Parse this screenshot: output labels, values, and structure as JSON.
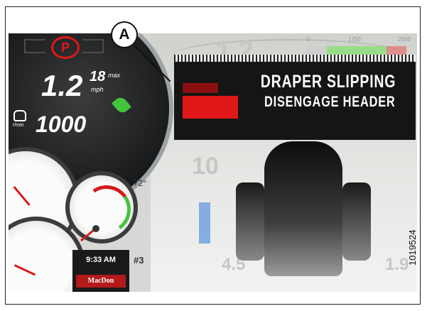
{
  "screen": {
    "parking_icon": "P",
    "speed_value": "1.2",
    "speed_max_value": "18",
    "speed_max_label": "max",
    "speed_unit": "mph",
    "engine_rpm": "1000",
    "rpm_unit": "r/min",
    "temperature": "72°",
    "gear": "#3",
    "time": "9:33 AM",
    "logo_text": "MacDon",
    "warning_line1": "DRAPER SLIPPING",
    "warning_line2": "DISENGAGE HEADER",
    "bg_speed": "1.2",
    "bg_reel": "10",
    "bg_left_value": "4.5",
    "bg_right_value": "1.9",
    "scale_labels": [
      "0",
      "1750",
      "2500"
    ],
    "colors": {
      "warning_red": "#e01818",
      "eco_green": "#43c43b",
      "gauge_red": "#d61a1a",
      "brand_red": "#b31a1a"
    }
  },
  "callout": {
    "label": "A"
  },
  "figure_id": "1019524"
}
